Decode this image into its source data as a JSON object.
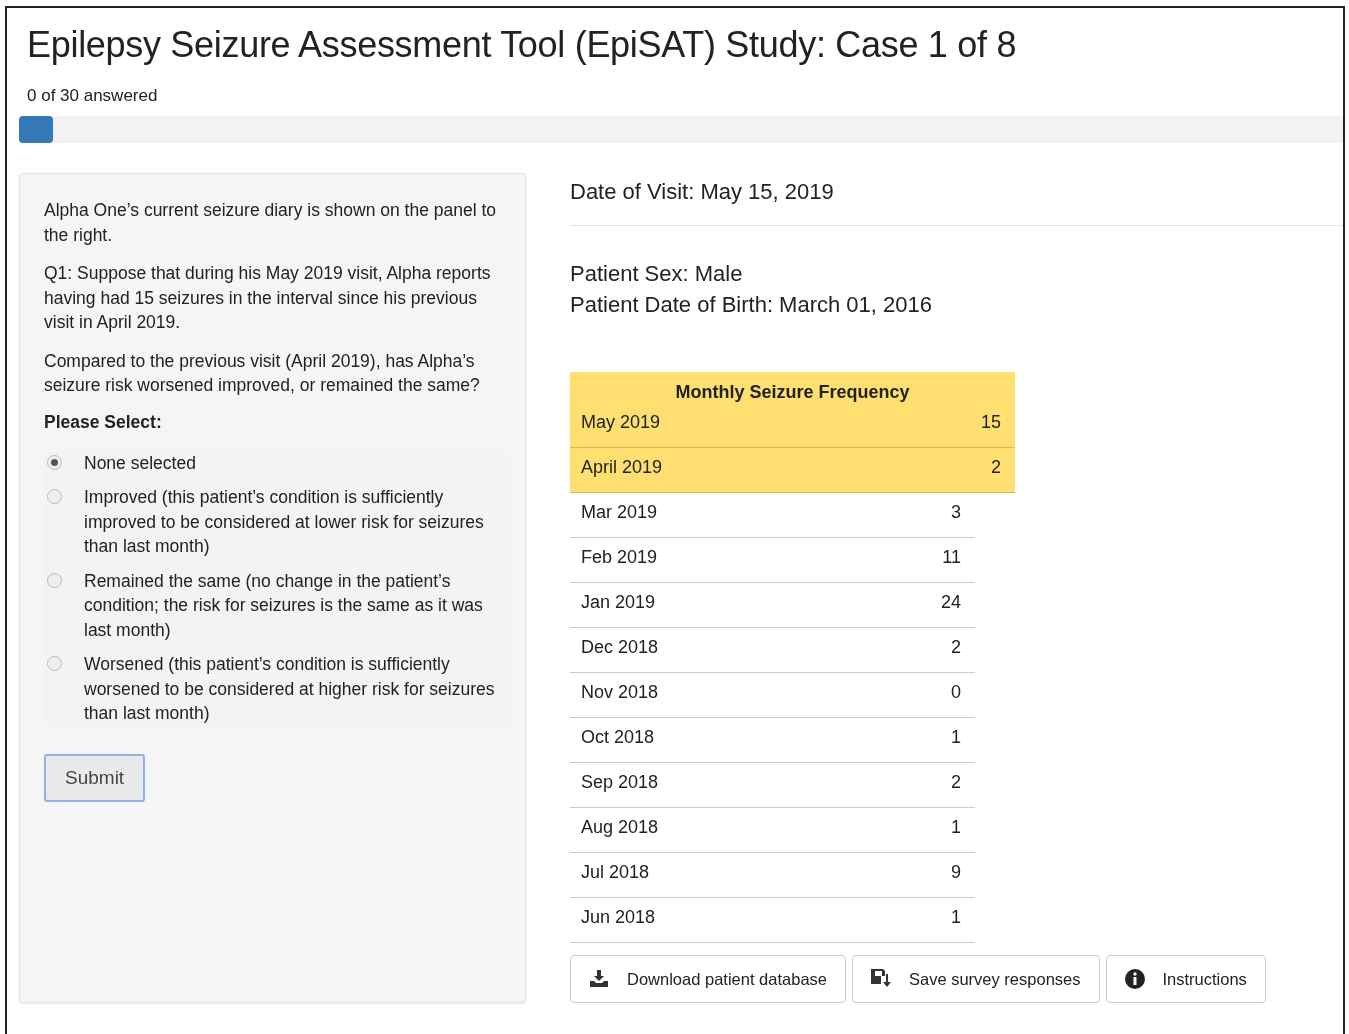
{
  "title": "Epilepsy Seizure Assessment Tool (EpiSAT) Study: Case 1 of 8",
  "progress": {
    "text": "0 of 30 answered",
    "level": 0.026
  },
  "question_panel": {
    "paragraphs": [
      "Alpha One’s current seizure diary is shown on the panel to the right.",
      "Q1: Suppose that during his May 2019 visit, Alpha reports having had 15 seizures in the interval since his previous visit in April 2019.",
      "Compared to the previous visit (April 2019), has Alpha’s seizure risk worsened improved, or remained the same?"
    ],
    "prompt": "Please Select:",
    "options": [
      {
        "label": "None selected",
        "selected": true
      },
      {
        "label": "Improved (this patient’s condition is sufficiently improved to be considered at lower risk for seizures than last month)",
        "selected": false
      },
      {
        "label": "Remained the same (no change in the patient’s condition; the risk for seizures is the same as it was last month)",
        "selected": false
      },
      {
        "label": "Worsened (this patient’s condition is sufficiently worsened to be considered at higher risk for seizures than last month)",
        "selected": false
      }
    ],
    "submit": "Submit"
  },
  "visit": "Date of Visit: May 15, 2019",
  "patient": [
    "Patient Sex: Male",
    "Patient Date of Birth: March 01, 2016"
  ],
  "table": {
    "title": "Monthly Seizure Frequency",
    "rows": [
      {
        "month": "May 2019",
        "count": "15",
        "highlighted": true
      },
      {
        "month": "April 2019",
        "count": "2",
        "highlighted": true
      },
      {
        "month": "Mar 2019",
        "count": "3",
        "highlighted": false
      },
      {
        "month": "Feb 2019",
        "count": "11",
        "highlighted": false
      },
      {
        "month": "Jan 2019",
        "count": "24",
        "highlighted": false
      },
      {
        "month": "Dec 2018",
        "count": "2",
        "highlighted": false
      },
      {
        "month": "Nov 2018",
        "count": "0",
        "highlighted": false
      },
      {
        "month": "Oct 2018",
        "count": "1",
        "highlighted": false
      },
      {
        "month": "Sep 2018",
        "count": "2",
        "highlighted": false
      },
      {
        "month": "Aug 2018",
        "count": "1",
        "highlighted": false
      },
      {
        "month": "Jul 2018",
        "count": "9",
        "highlighted": false
      },
      {
        "month": "Jun 2018",
        "count": "1",
        "highlighted": false
      }
    ]
  },
  "buttons": [
    {
      "kind": "download",
      "label": "Download patient database"
    },
    {
      "kind": "save",
      "label": "Save survey responses"
    },
    {
      "kind": "info",
      "label": "Instructions"
    }
  ]
}
